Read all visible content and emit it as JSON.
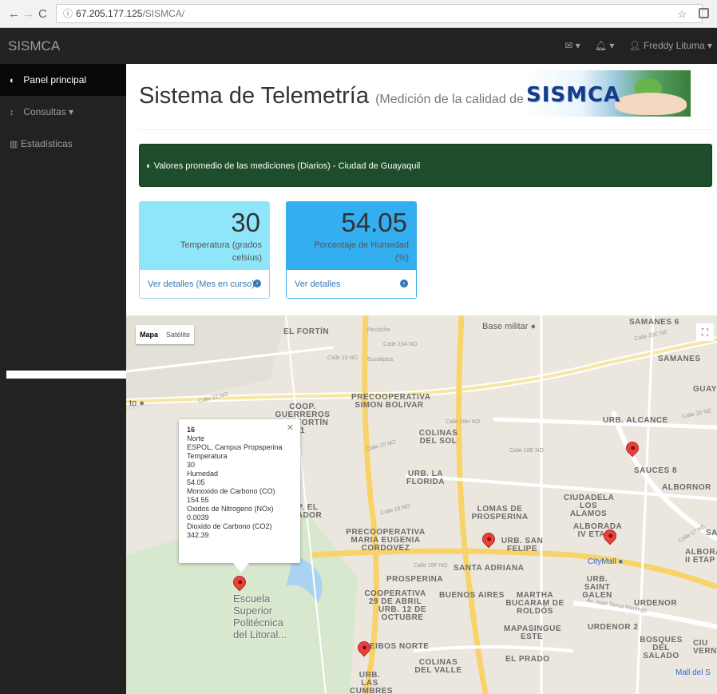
{
  "browser": {
    "url_host": "67.205.177.125",
    "url_path": "/SISMCA/"
  },
  "navbar": {
    "brand": "SISMCA",
    "user": "Freddy Lituma",
    "mail_caret": "▾",
    "bell_caret": "▾"
  },
  "sidebar": {
    "items": [
      {
        "label": "Panel principal"
      },
      {
        "label": "Consultas"
      },
      {
        "label": "Estadísticas"
      }
    ]
  },
  "header": {
    "title": "Sistema de Telemetría",
    "subtitle": "(Medición de la calidad del aire)",
    "logo_text": "SISMCA"
  },
  "banner": {
    "text": "Valores promedio de las mediciones (Diarios) - Ciudad de Guayaquil"
  },
  "stats": [
    {
      "value": "30",
      "label": "Temperatura (grados celsius)",
      "link": "Ver detalles (Mes en curso)"
    },
    {
      "value": "54.05",
      "label": "Porcentaje de Humedad (%)",
      "link": "Ver detalles"
    }
  ],
  "map": {
    "type_map": "Mapa",
    "type_satellite": "Satélite",
    "info": {
      "id": "16",
      "zone": "Norte",
      "location": "ESPOL, Campus Propsperina",
      "temp_label": "Temperatura",
      "temp": "30",
      "hum_label": "Humedad",
      "hum": "54.05",
      "co_label": "Monoxido de Carbono (CO)",
      "co": "154.55",
      "nox_label": "Oxidos de Nitrogeno (NOx)",
      "nox": "0.0039",
      "co2_label": "Dioxido de Carbono (CO2)",
      "co2": "342.39"
    },
    "places": [
      "EL FORTÍN",
      "COOP. GUERREROS DEL FORTÍN 1",
      "PRECOOPERATIVA SIMON BOLIVAR",
      "COLINAS DEL SOL",
      "URB. LA FLORIDA",
      "URB. ALCANCE",
      "SAUCES 8",
      "ALBORNOR",
      "CIUDADELA LOS ALAMOS",
      "LOMAS DE PROSPERINA",
      "ALBORADA IV ETAPA",
      "URB. SAN FELIPE",
      "PRECOOPERATIVA MARIA EUGENIA CORDOVEZ",
      "SANTA ADRIANA",
      "PROSPERINA",
      "COOPERATIVA 29 DE ABRIL",
      "URB. 12 DE OCTUBRE",
      "BUENOS AIRES",
      "MARTHA BUCARAM DE ROLDÓS",
      "MAPASINGUE ESTE",
      "URB. SAINT GALEN",
      "URDENOR",
      "URDENOR 2",
      "BOSQUES DEL SALADO",
      "EIBOS NORTE",
      "COLINAS DEL VALLE",
      "URB. LAS CUMBRES",
      "EL PRADO",
      "SAMANES 6",
      "SAMANES",
      "GUAY",
      "OP. EL RADOR",
      "CIU VERNA",
      "ALBORA II ETAP",
      "SA"
    ],
    "pois": {
      "base": "Base militar",
      "mall": "CityMall",
      "mall2": "Mall del S",
      "to": "to"
    },
    "streets": [
      "Calle 22 NO",
      "Calle 20 NO",
      "Calle 23A NO",
      "Calle 19E NO",
      "Calle 18F NO",
      "Calle 20C NE",
      "Av. Juan Tanca Marengo",
      "Pechiche",
      "Eucaliptos",
      "Calle 23 NO",
      "Calle 19H NO",
      "Calle 18 NO",
      "Calle 17 NE",
      "Calle 20 NE"
    ],
    "campus": "Escuela Superior Politécnica del Litoral..."
  }
}
